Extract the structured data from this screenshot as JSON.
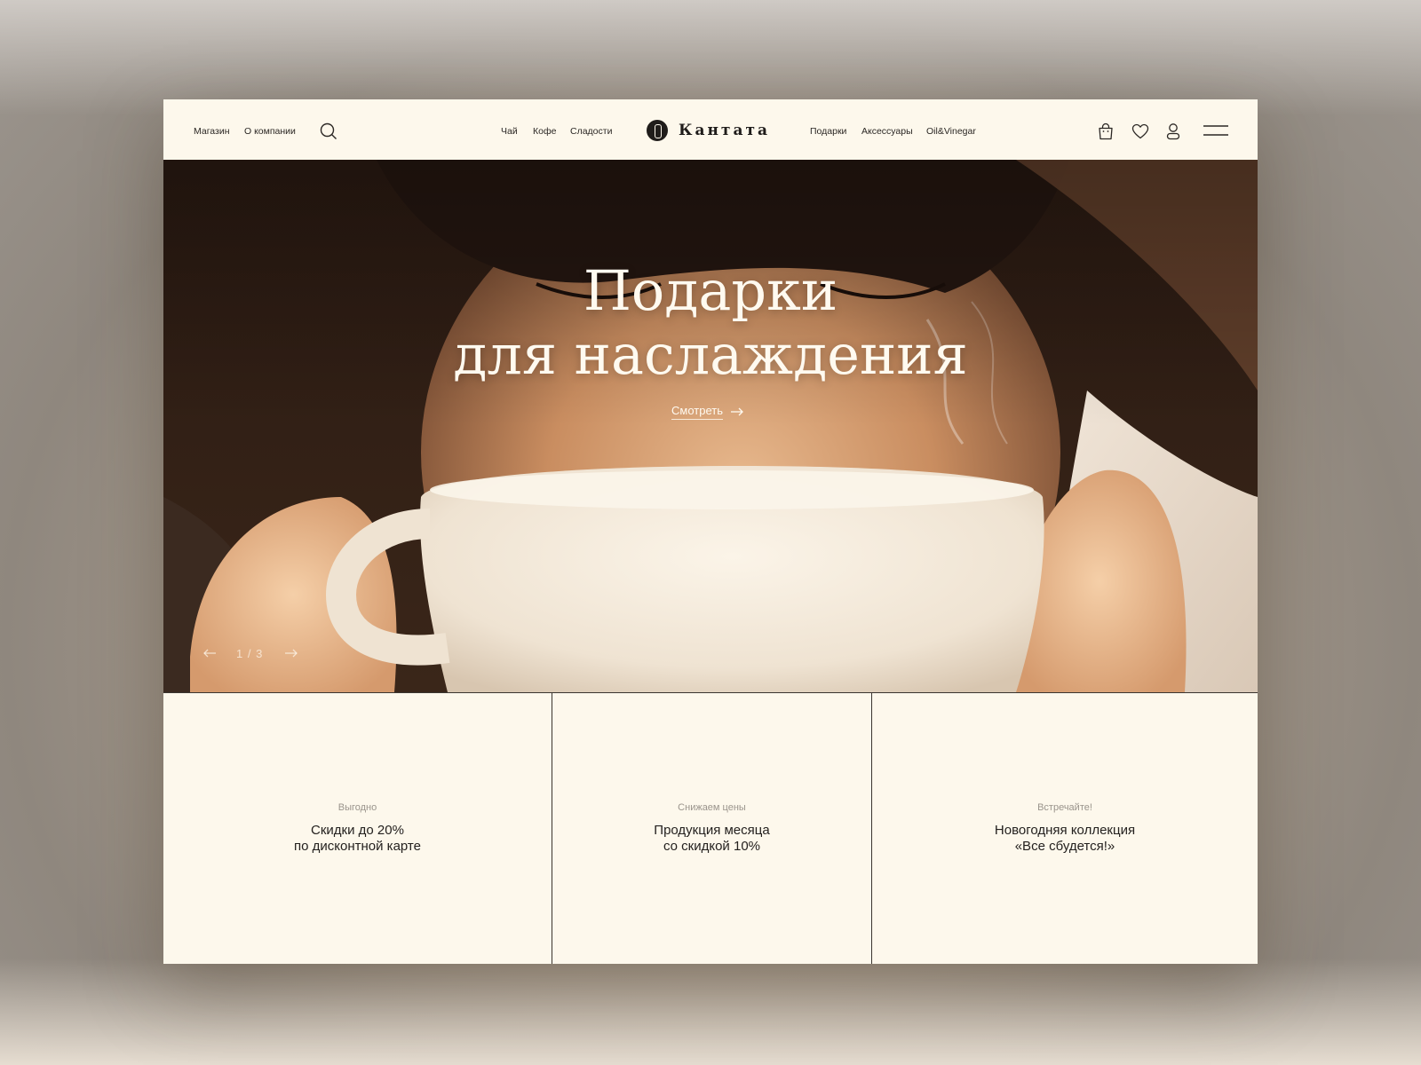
{
  "header": {
    "nav_left": [
      "Магазин",
      "О компании"
    ],
    "nav_center_left": [
      "Чай",
      "Кофе",
      "Сладости"
    ],
    "logo_text": "Кантата",
    "nav_center_right": [
      "Подарки",
      "Аксессуары",
      "Oil&Vinegar"
    ],
    "icons": [
      "search-icon",
      "bag-icon",
      "heart-icon",
      "user-icon",
      "menu-icon"
    ]
  },
  "hero": {
    "title_line1": "Подарки",
    "title_line2": "для наслаждения",
    "cta_label": "Смотреть",
    "slider_counter": "1 / 3"
  },
  "promos": [
    {
      "kicker": "Выгодно",
      "line1": "Скидки до 20%",
      "line2": "по дисконтной карте"
    },
    {
      "kicker": "Снижаем цены",
      "line1": "Продукция месяца",
      "line2": "со скидкой 10%"
    },
    {
      "kicker": "Встречайте!",
      "line1": "Новогодняя коллекция",
      "line2": "«Все сбудется!»"
    }
  ],
  "colors": {
    "page_bg": "#fdf8ec",
    "text_dark": "#24211f",
    "text_muted": "#9a948c",
    "hero_text": "#fffaf0"
  }
}
